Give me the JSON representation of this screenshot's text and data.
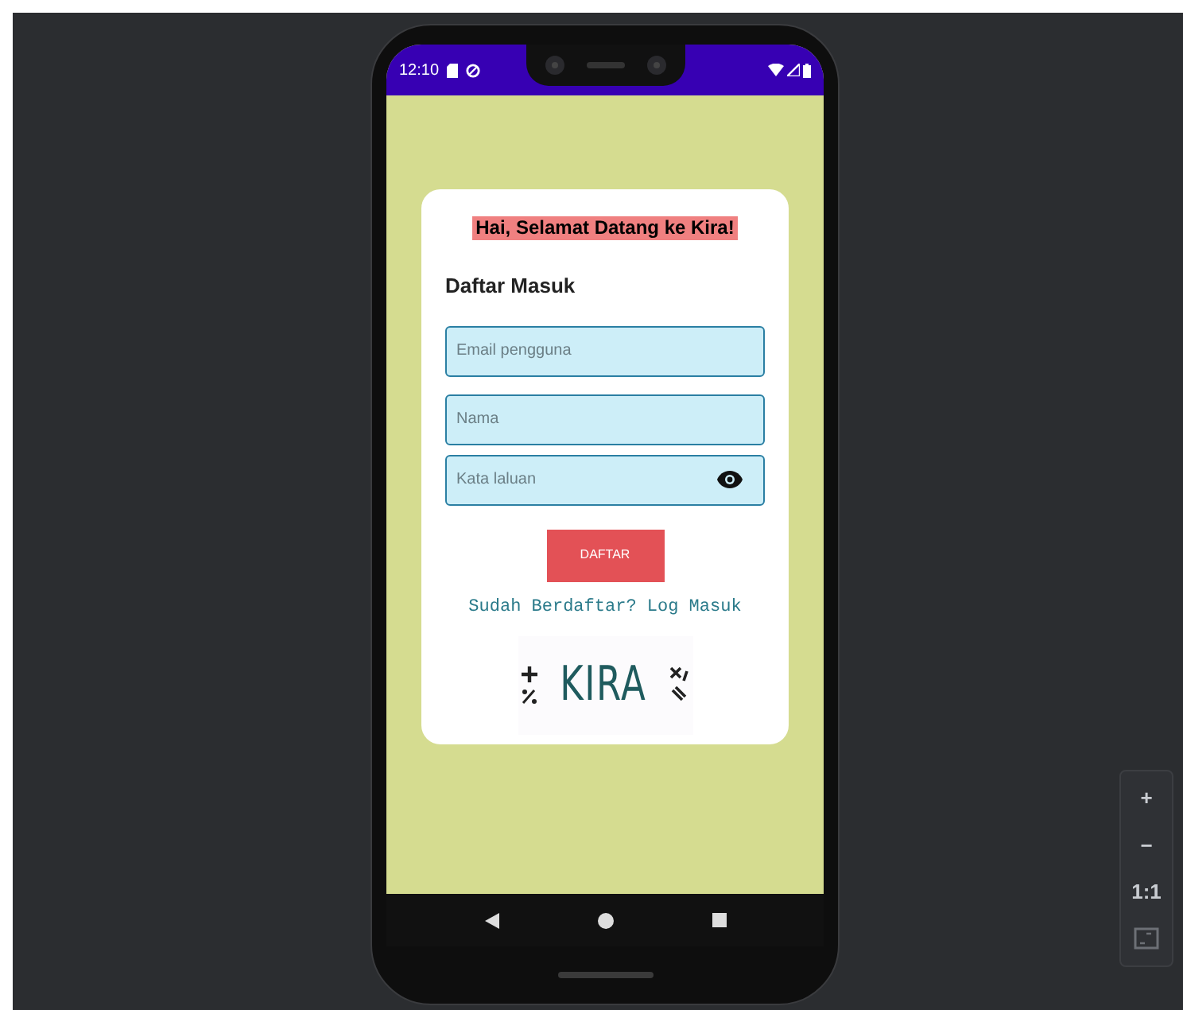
{
  "status_bar": {
    "time": "12:10"
  },
  "card": {
    "greeting": "Hai, Selamat Datang ke Kira!",
    "heading": "Daftar Masuk",
    "fields": [
      {
        "kind": "text",
        "placeholder": "Email pengguna"
      },
      {
        "kind": "text",
        "placeholder": "Nama"
      },
      {
        "kind": "password",
        "placeholder": "Kata laluan"
      }
    ],
    "submit_button": "DAFTAR",
    "login_link": "Sudah Berdaftar? Log Masuk",
    "logo": {
      "text": "KIRA"
    }
  },
  "zoom_controls": [
    {
      "kind": "text",
      "label": "+"
    },
    {
      "kind": "text",
      "label": "−"
    },
    {
      "kind": "text",
      "label": "1:1"
    },
    {
      "kind": "fit"
    }
  ]
}
